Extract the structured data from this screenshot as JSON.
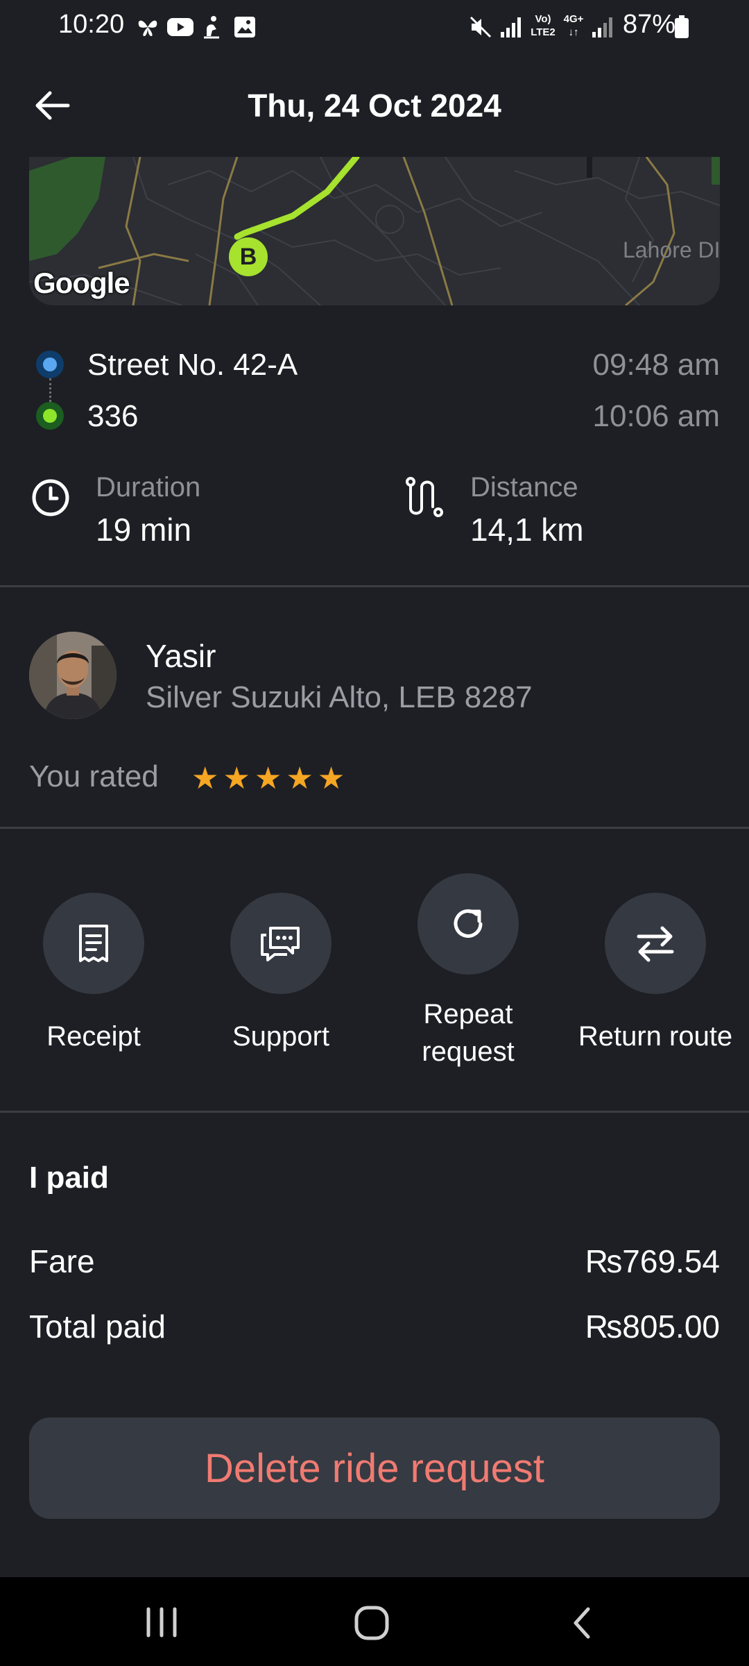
{
  "status_bar": {
    "time": "10:20",
    "battery": "87%",
    "icons": [
      "butterfly-icon",
      "youtube-icon",
      "figure-icon",
      "gallery-icon",
      "mute-icon",
      "signal-icon",
      "volte-icon",
      "4g-icon",
      "signal-icon",
      "battery-icon"
    ],
    "network_labels": {
      "volte": "Vo)",
      "lte": "LTE2",
      "four_g": "4G+"
    }
  },
  "header": {
    "title": "Thu, 24 Oct 2024",
    "back_icon": "arrow-left-icon"
  },
  "map": {
    "google_label": "Google",
    "place_label": "Lahore DI",
    "marker_label": "B",
    "route_color": "#a6e22e"
  },
  "route": {
    "pickup": {
      "address": "Street No. 42-A",
      "time": "09:48 am"
    },
    "dropoff": {
      "address": "336",
      "time": "10:06 am"
    }
  },
  "stats": {
    "duration": {
      "label": "Duration",
      "value": "19 min",
      "icon": "clock-icon"
    },
    "distance": {
      "label": "Distance",
      "value": "14,1 km",
      "icon": "route-icon"
    }
  },
  "driver": {
    "name": "Yasir",
    "car": "Silver Suzuki Alto, LEB 8287",
    "rated_label": "You rated",
    "rating": 5,
    "stars": [
      "★",
      "★",
      "★",
      "★",
      "★"
    ]
  },
  "actions": [
    {
      "label": "Receipt",
      "icon": "receipt-icon"
    },
    {
      "label": "Support",
      "icon": "chat-icon"
    },
    {
      "label": "Repeat request",
      "icon": "refresh-icon"
    },
    {
      "label": "Return route",
      "icon": "swap-arrows-icon"
    }
  ],
  "payment": {
    "title": "I paid",
    "fare_label": "Fare",
    "fare_value": "₨769.54",
    "total_label": "Total paid",
    "total_value": "₨805.00"
  },
  "delete_button": "Delete ride request",
  "colors": {
    "background": "#1d1f24",
    "accent_delete": "#f07b72",
    "star": "#f5a623",
    "route": "#a6e22e"
  }
}
